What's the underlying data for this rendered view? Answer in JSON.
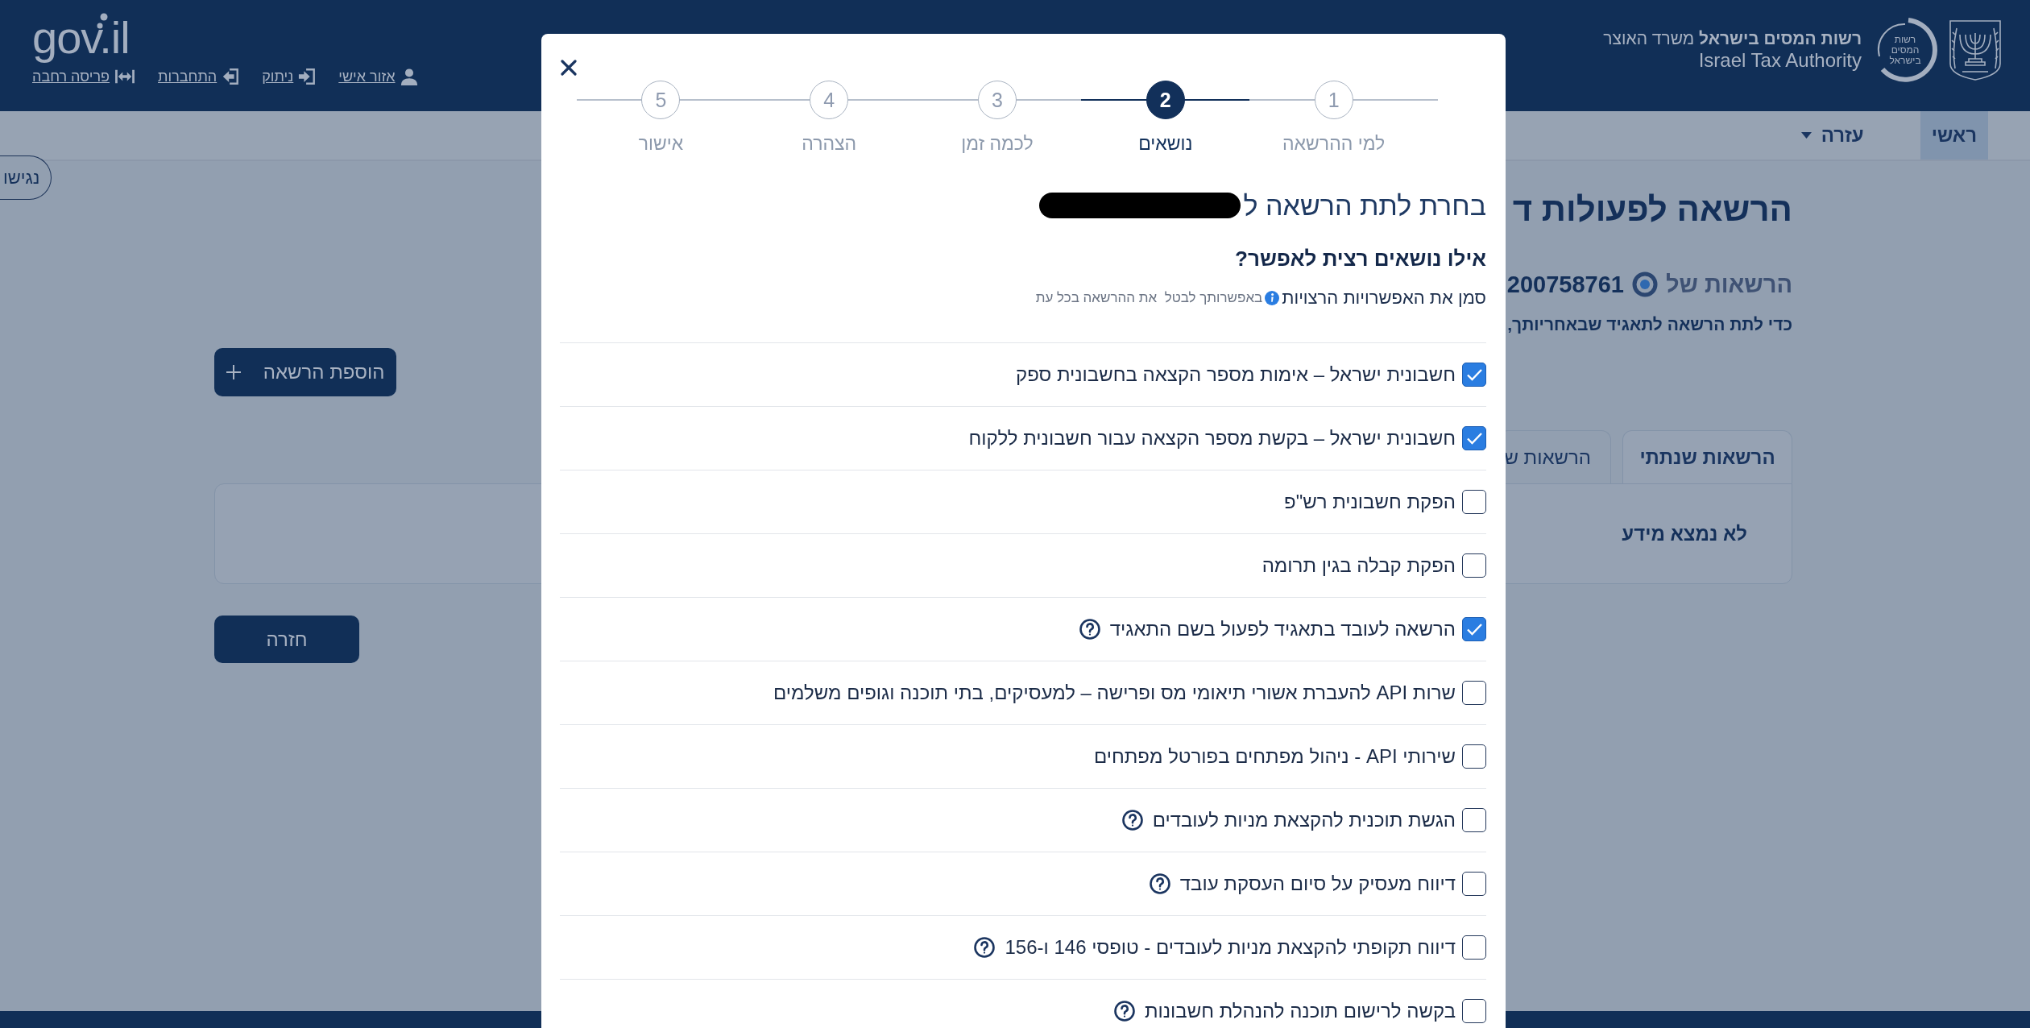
{
  "header": {
    "authority": {
      "name": "**רשות המסים בישראל** משרד האוצר",
      "english": "Israel Tax Authority",
      "logo_lines": [
        "רשות",
        "המסים",
        "בישראל"
      ]
    },
    "logo": "gov.il",
    "links": [
      {
        "kind": "account",
        "label": "אזור אישי"
      },
      {
        "kind": "logout",
        "label": "ניתוק"
      },
      {
        "kind": "login",
        "label": "התחברות"
      },
      {
        "kind": "layout",
        "label": "פריסה רחבה"
      }
    ]
  },
  "nav": {
    "items": [
      {
        "label": "ראשי",
        "selected": true,
        "dropdown": false
      },
      {
        "label": "עזרה",
        "selected": false,
        "dropdown": true
      }
    ]
  },
  "accessibility_button": {
    "label": "נגישו"
  },
  "page": {
    "title": "הרשאה לפעולות ד",
    "owner_label": "הרשאות של",
    "owner_id": "200758761",
    "instruction": "כדי לתת הרשאה לתאגיד שבאחריותך,",
    "add_button": "הוספת הרשאה",
    "tabs": [
      {
        "label": "הרשאות שנתתי",
        "selected": true
      },
      {
        "label": "הרשאות ש",
        "selected": false
      }
    ],
    "empty_message": "לא נמצא מידע",
    "back_button": "חזרה"
  },
  "modal": {
    "steps": [
      {
        "number": "1",
        "label": "למי ההרשאה",
        "selected": false
      },
      {
        "number": "2",
        "label": "נושאים",
        "selected": true
      },
      {
        "number": "3",
        "label": "לכמה זמן",
        "selected": false
      },
      {
        "number": "4",
        "label": "הצהרה",
        "selected": false
      },
      {
        "number": "5",
        "label": "אישור",
        "selected": false
      }
    ],
    "title": "בחרת לתת הרשאה ל",
    "title_redacted": true,
    "question": "אילו נושאים רצית לאפשר?",
    "hint": "סמן את האפשרויות הרצויות",
    "note": "באפשרותך לבטל  את ההרשאה בכל עת",
    "options": [
      {
        "label": "חשבונית ישראל – אימות מספר הקצאה בחשבונית ספק",
        "checked": true,
        "help": false
      },
      {
        "label": "חשבונית ישראל – בקשת מספר הקצאה עבור חשבונית ללקוח",
        "checked": true,
        "help": false
      },
      {
        "label": "הפקת חשבונית רש\"פ",
        "checked": false,
        "help": false
      },
      {
        "label": "הפקת קבלה בגין תרומה",
        "checked": false,
        "help": false
      },
      {
        "label": "הרשאה לעובד בתאגיד לפעול בשם התאגיד",
        "checked": true,
        "help": true
      },
      {
        "label": "שרות API להעברת אשורי תיאומי מס ופרישה – למעסיקים, בתי תוכנה וגופים משלמים",
        "checked": false,
        "help": false
      },
      {
        "label": "שירותי API - ניהול מפתחים בפורטל מפתחים",
        "checked": false,
        "help": false
      },
      {
        "label": "הגשת תוכנית להקצאת מניות לעובדים",
        "checked": false,
        "help": true
      },
      {
        "label": "דיווח מעסיק על סיום העסקת עובד",
        "checked": false,
        "help": true
      },
      {
        "label": "דיווח תקופתי להקצאת מניות לעובדים - טופסי 146 ו-156",
        "checked": false,
        "help": true
      },
      {
        "label": "בקשה לרישום תוכנה להנהלת חשבונות",
        "checked": false,
        "help": true
      }
    ]
  }
}
